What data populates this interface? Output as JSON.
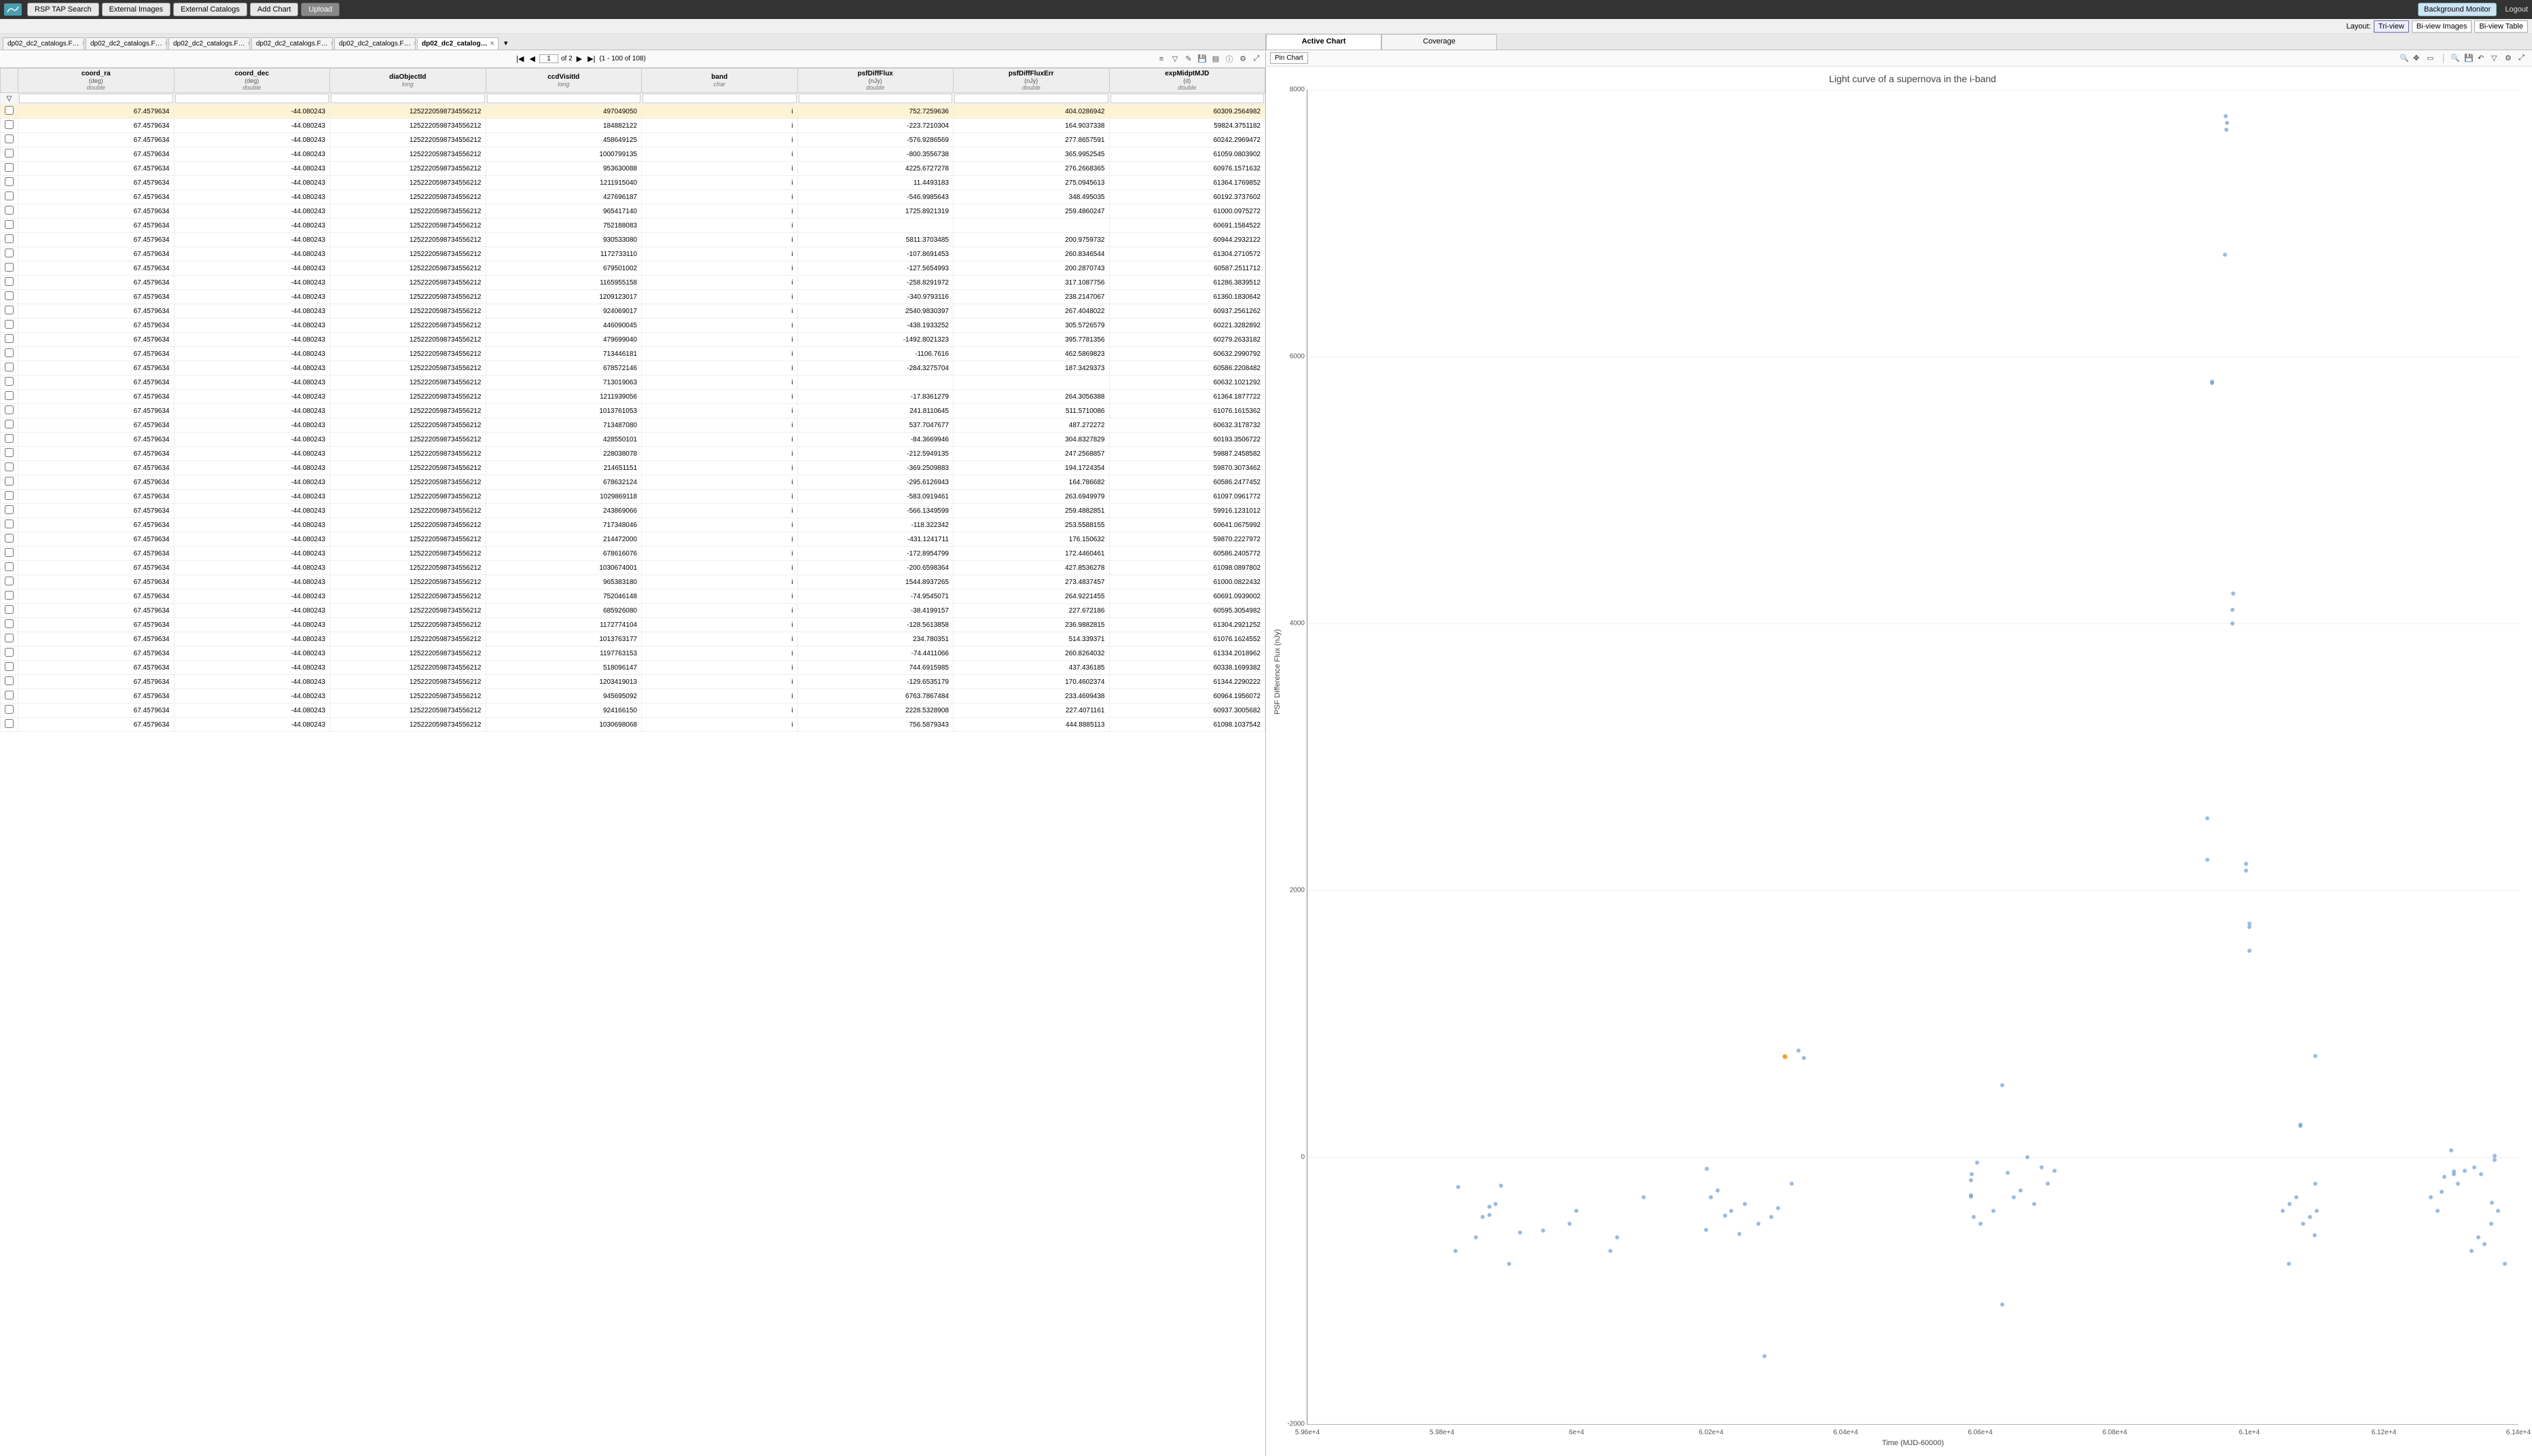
{
  "topbar": {
    "buttons": [
      "RSP TAP Search",
      "External Images",
      "External Catalogs",
      "Add Chart",
      "Upload"
    ],
    "bg_monitor": "Background Monitor",
    "logout": "Logout"
  },
  "layout": {
    "label": "Layout:",
    "options": [
      "Tri-view",
      "Bi-view Images",
      "Bi-view Table"
    ],
    "active": 0
  },
  "tabs": {
    "items": [
      "dp02_dc2_catalogs.F…",
      "dp02_dc2_catalogs.F…",
      "dp02_dc2_catalogs.F…",
      "dp02_dc2_catalogs.F…",
      "dp02_dc2_catalogs.F…",
      "dp02_dc2_catalog…"
    ],
    "active": 5
  },
  "pager": {
    "page": "1",
    "of_label": "of 2",
    "range": "(1 - 100 of 108)"
  },
  "columns": [
    {
      "name": "",
      "unit": "",
      "dtype": ""
    },
    {
      "name": "coord_ra",
      "unit": "(deg)",
      "dtype": "double"
    },
    {
      "name": "coord_dec",
      "unit": "(deg)",
      "dtype": "double"
    },
    {
      "name": "diaObjectId",
      "unit": "",
      "dtype": "long"
    },
    {
      "name": "ccdVisitId",
      "unit": "",
      "dtype": "long"
    },
    {
      "name": "band",
      "unit": "",
      "dtype": "char"
    },
    {
      "name": "psfDiffFlux",
      "unit": "(nJy)",
      "dtype": "double"
    },
    {
      "name": "psfDiffFluxErr",
      "unit": "(nJy)",
      "dtype": "double"
    },
    {
      "name": "expMidptMJD",
      "unit": "(d)",
      "dtype": "double"
    }
  ],
  "rows": [
    [
      "67.4579634",
      "-44.080243",
      "1252220598734556212",
      "497049050",
      "i",
      "752.7259636",
      "404.0286942",
      "60309.2564982"
    ],
    [
      "67.4579634",
      "-44.080243",
      "1252220598734556212",
      "184882122",
      "i",
      "-223.7210304",
      "164.9037338",
      "59824.3751182"
    ],
    [
      "67.4579634",
      "-44.080243",
      "1252220598734556212",
      "458649125",
      "i",
      "-576.9286569",
      "277.8657591",
      "60242.2969472"
    ],
    [
      "67.4579634",
      "-44.080243",
      "1252220598734556212",
      "1000799135",
      "i",
      "-800.3556738",
      "365.9952545",
      "61059.0803902"
    ],
    [
      "67.4579634",
      "-44.080243",
      "1252220598734556212",
      "953630088",
      "i",
      "4225.6727278",
      "276.2668365",
      "60976.1571632"
    ],
    [
      "67.4579634",
      "-44.080243",
      "1252220598734556212",
      "1211915040",
      "i",
      "11.4493183",
      "275.0945613",
      "61364.1769852"
    ],
    [
      "67.4579634",
      "-44.080243",
      "1252220598734556212",
      "427696187",
      "i",
      "-546.9985643",
      "348.495035",
      "60192.3737602"
    ],
    [
      "67.4579634",
      "-44.080243",
      "1252220598734556212",
      "965417140",
      "i",
      "1725.8921319",
      "259.4860247",
      "61000.0975272"
    ],
    [
      "67.4579634",
      "-44.080243",
      "1252220598734556212",
      "752188083",
      "i",
      "",
      "",
      "60691.1584522"
    ],
    [
      "67.4579634",
      "-44.080243",
      "1252220598734556212",
      "930533080",
      "i",
      "5811.3703485",
      "200.9759732",
      "60944.2932122"
    ],
    [
      "67.4579634",
      "-44.080243",
      "1252220598734556212",
      "1172733110",
      "i",
      "-107.8691453",
      "260.8346544",
      "61304.2710572"
    ],
    [
      "67.4579634",
      "-44.080243",
      "1252220598734556212",
      "679501002",
      "i",
      "-127.5654993",
      "200.2870743",
      "60587.2511712"
    ],
    [
      "67.4579634",
      "-44.080243",
      "1252220598734556212",
      "1165955158",
      "i",
      "-258.8291972",
      "317.1087756",
      "61286.3839512"
    ],
    [
      "67.4579634",
      "-44.080243",
      "1252220598734556212",
      "1209123017",
      "i",
      "-340.9793116",
      "238.2147067",
      "61360.1830642"
    ],
    [
      "67.4579634",
      "-44.080243",
      "1252220598734556212",
      "924069017",
      "i",
      "2540.9830397",
      "267.4048022",
      "60937.2561262"
    ],
    [
      "67.4579634",
      "-44.080243",
      "1252220598734556212",
      "446090045",
      "i",
      "-438.1933252",
      "305.5726579",
      "60221.3282892"
    ],
    [
      "67.4579634",
      "-44.080243",
      "1252220598734556212",
      "479699040",
      "i",
      "-1492.8021323",
      "395.7781356",
      "60279.2633182"
    ],
    [
      "67.4579634",
      "-44.080243",
      "1252220598734556212",
      "713446181",
      "i",
      "-1106.7616",
      "462.5869823",
      "60632.2990792"
    ],
    [
      "67.4579634",
      "-44.080243",
      "1252220598734556212",
      "678572146",
      "i",
      "-284.3275704",
      "187.3429373",
      "60586.2208482"
    ],
    [
      "67.4579634",
      "-44.080243",
      "1252220598734556212",
      "713019063",
      "i",
      "",
      "",
      "60632.1021292"
    ],
    [
      "67.4579634",
      "-44.080243",
      "1252220598734556212",
      "1211939056",
      "i",
      "-17.8361279",
      "264.3056388",
      "61364.1877722"
    ],
    [
      "67.4579634",
      "-44.080243",
      "1252220598734556212",
      "1013761053",
      "i",
      "241.8110645",
      "511.5710086",
      "61076.1615362"
    ],
    [
      "67.4579634",
      "-44.080243",
      "1252220598734556212",
      "713487080",
      "i",
      "537.7047677",
      "487.272272",
      "60632.3178732"
    ],
    [
      "67.4579634",
      "-44.080243",
      "1252220598734556212",
      "428550101",
      "i",
      "-84.3669946",
      "304.8327829",
      "60193.3506722"
    ],
    [
      "67.4579634",
      "-44.080243",
      "1252220598734556212",
      "228038078",
      "i",
      "-212.5949135",
      "247.2568857",
      "59887.2458582"
    ],
    [
      "67.4579634",
      "-44.080243",
      "1252220598734556212",
      "214651151",
      "i",
      "-369.2509883",
      "194.1724354",
      "59870.3073462"
    ],
    [
      "67.4579634",
      "-44.080243",
      "1252220598734556212",
      "678632124",
      "i",
      "-295.6126943",
      "164.786682",
      "60586.2477452"
    ],
    [
      "67.4579634",
      "-44.080243",
      "1252220598734556212",
      "1029869118",
      "i",
      "-583.0919461",
      "263.6949979",
      "61097.0961772"
    ],
    [
      "67.4579634",
      "-44.080243",
      "1252220598734556212",
      "243869066",
      "i",
      "-566.1349599",
      "259.4882851",
      "59916.1231012"
    ],
    [
      "67.4579634",
      "-44.080243",
      "1252220598734556212",
      "717348046",
      "i",
      "-118.322342",
      "253.5588155",
      "60641.0675992"
    ],
    [
      "67.4579634",
      "-44.080243",
      "1252220598734556212",
      "214472000",
      "i",
      "-431.1241711",
      "176.150632",
      "59870.2227972"
    ],
    [
      "67.4579634",
      "-44.080243",
      "1252220598734556212",
      "678616076",
      "i",
      "-172.8954799",
      "172.4460461",
      "60586.2405772"
    ],
    [
      "67.4579634",
      "-44.080243",
      "1252220598734556212",
      "1030674001",
      "i",
      "-200.6598364",
      "427.8536278",
      "61098.0897802"
    ],
    [
      "67.4579634",
      "-44.080243",
      "1252220598734556212",
      "965383180",
      "i",
      "1544.8937265",
      "273.4837457",
      "61000.0822432"
    ],
    [
      "67.4579634",
      "-44.080243",
      "1252220598734556212",
      "752046148",
      "i",
      "-74.9545071",
      "264.9221455",
      "60691.0939002"
    ],
    [
      "67.4579634",
      "-44.080243",
      "1252220598734556212",
      "685926080",
      "i",
      "-38.4199157",
      "227.672186",
      "60595.3054982"
    ],
    [
      "67.4579634",
      "-44.080243",
      "1252220598734556212",
      "1172774104",
      "i",
      "-128.5613858",
      "236.9882815",
      "61304.2921252"
    ],
    [
      "67.4579634",
      "-44.080243",
      "1252220598734556212",
      "1013763177",
      "i",
      "234.780351",
      "514.339371",
      "61076.1624552"
    ],
    [
      "67.4579634",
      "-44.080243",
      "1252220598734556212",
      "1197763153",
      "i",
      "-74.4411066",
      "260.8264032",
      "61334.2018962"
    ],
    [
      "67.4579634",
      "-44.080243",
      "1252220598734556212",
      "518096147",
      "i",
      "744.6915985",
      "437.436185",
      "60338.1699382"
    ],
    [
      "67.4579634",
      "-44.080243",
      "1252220598734556212",
      "1203419013",
      "i",
      "-129.6535179",
      "170.4602374",
      "61344.2290222"
    ],
    [
      "67.4579634",
      "-44.080243",
      "1252220598734556212",
      "945695092",
      "i",
      "6763.7867484",
      "233.4699438",
      "60964.1956072"
    ],
    [
      "67.4579634",
      "-44.080243",
      "1252220598734556212",
      "924166150",
      "i",
      "2228.5328908",
      "227.4071161",
      "60937.3005682"
    ],
    [
      "67.4579634",
      "-44.080243",
      "1252220598734556212",
      "1030698068",
      "i",
      "756.5879343",
      "444.8885113",
      "61098.1037542"
    ]
  ],
  "chart": {
    "tabs": [
      "Active Chart",
      "Coverage"
    ],
    "active": 0,
    "pin": "Pin Chart"
  },
  "chart_data": {
    "type": "scatter",
    "title": "Light curve of a supernova in the i-band",
    "xlabel": "Time (MJD-60000)",
    "ylabel": "PSF Difference Flux (nJy)",
    "xlim": [
      59600,
      61400
    ],
    "ylim": [
      -2000,
      8000
    ],
    "yticks": [
      -2000,
      0,
      2000,
      4000,
      6000,
      8000
    ],
    "xticks": [
      59600,
      59800,
      60000,
      60200,
      60400,
      60600,
      60800,
      61000,
      61200,
      61400
    ],
    "xtick_labels": [
      "5.96e+4",
      "5.98e+4",
      "6e+4",
      "6.02e+4",
      "6.04e+4",
      "6.06e+4",
      "6.08e+4",
      "6.1e+4",
      "6.12e+4",
      "6.14e+4"
    ],
    "selected": {
      "x": 60309.26,
      "y": 752.73
    },
    "points": [
      [
        60309.26,
        752.73
      ],
      [
        59824.38,
        -223.72
      ],
      [
        60242.3,
        -576.93
      ],
      [
        61059.08,
        -800.36
      ],
      [
        60976.16,
        4225.67
      ],
      [
        61364.18,
        11.45
      ],
      [
        60192.37,
        -547.0
      ],
      [
        61000.1,
        1725.89
      ],
      [
        60944.29,
        5811.37
      ],
      [
        61304.27,
        -107.87
      ],
      [
        60587.25,
        -127.57
      ],
      [
        61286.38,
        -258.83
      ],
      [
        61360.18,
        -340.98
      ],
      [
        60937.26,
        2540.98
      ],
      [
        60221.33,
        -438.19
      ],
      [
        60279.26,
        -1492.8
      ],
      [
        60632.3,
        -1106.76
      ],
      [
        60586.22,
        -284.33
      ],
      [
        61364.19,
        -17.84
      ],
      [
        61076.16,
        241.81
      ],
      [
        60632.32,
        537.7
      ],
      [
        60193.35,
        -84.37
      ],
      [
        59887.25,
        -212.59
      ],
      [
        59870.31,
        -369.25
      ],
      [
        60586.25,
        -295.61
      ],
      [
        61097.1,
        -583.09
      ],
      [
        59916.12,
        -566.13
      ],
      [
        60641.07,
        -118.32
      ],
      [
        59870.22,
        -431.12
      ],
      [
        60586.24,
        -172.9
      ],
      [
        61098.09,
        -200.66
      ],
      [
        61000.08,
        1544.89
      ],
      [
        60691.09,
        -74.95
      ],
      [
        60595.31,
        -38.42
      ],
      [
        61304.29,
        -128.56
      ],
      [
        61076.16,
        234.78
      ],
      [
        61334.2,
        -74.44
      ],
      [
        60338.17,
        744.69
      ],
      [
        61344.23,
        -129.65
      ],
      [
        60964.2,
        6763.79
      ],
      [
        60937.3,
        2228.53
      ],
      [
        61098.1,
        756.59
      ],
      [
        60965,
        7800
      ],
      [
        60966,
        7700
      ],
      [
        60967,
        7750
      ],
      [
        60945,
        5800
      ],
      [
        60975,
        4100
      ],
      [
        60975,
        4000
      ],
      [
        61000,
        1750
      ],
      [
        60995,
        2200
      ],
      [
        60995,
        2150
      ],
      [
        61270,
        -300
      ],
      [
        61280,
        -400
      ],
      [
        61330,
        -700
      ],
      [
        61340,
        -600
      ],
      [
        61350,
        -650
      ],
      [
        61360,
        -500
      ],
      [
        61370,
        -400
      ],
      [
        61380,
        -800
      ],
      [
        61310,
        -200
      ],
      [
        61320,
        -100
      ],
      [
        61300,
        50
      ],
      [
        61290,
        -150
      ],
      [
        60700,
        -200
      ],
      [
        60710,
        -100
      ],
      [
        60650,
        -300
      ],
      [
        60660,
        -250
      ],
      [
        60670,
        0
      ],
      [
        60620,
        -400
      ],
      [
        60680,
        -350
      ],
      [
        60600,
        -500
      ],
      [
        60590,
        -450
      ],
      [
        60050,
        -700
      ],
      [
        60060,
        -600
      ],
      [
        60100,
        -300
      ],
      [
        60000,
        -400
      ],
      [
        59990,
        -500
      ],
      [
        59950,
        -550
      ],
      [
        59900,
        -800
      ],
      [
        59850,
        -600
      ],
      [
        59820,
        -700
      ],
      [
        59860,
        -450
      ],
      [
        59880,
        -350
      ],
      [
        60200,
        -300
      ],
      [
        60210,
        -250
      ],
      [
        60230,
        -400
      ],
      [
        60250,
        -350
      ],
      [
        60270,
        -500
      ],
      [
        60290,
        -450
      ],
      [
        60300,
        -380
      ],
      [
        60320,
        -200
      ],
      [
        60330,
        800
      ],
      [
        61050,
        -400
      ],
      [
        61060,
        -350
      ],
      [
        61070,
        -300
      ],
      [
        61080,
        -500
      ],
      [
        61090,
        -450
      ],
      [
        61100,
        -400
      ]
    ]
  }
}
